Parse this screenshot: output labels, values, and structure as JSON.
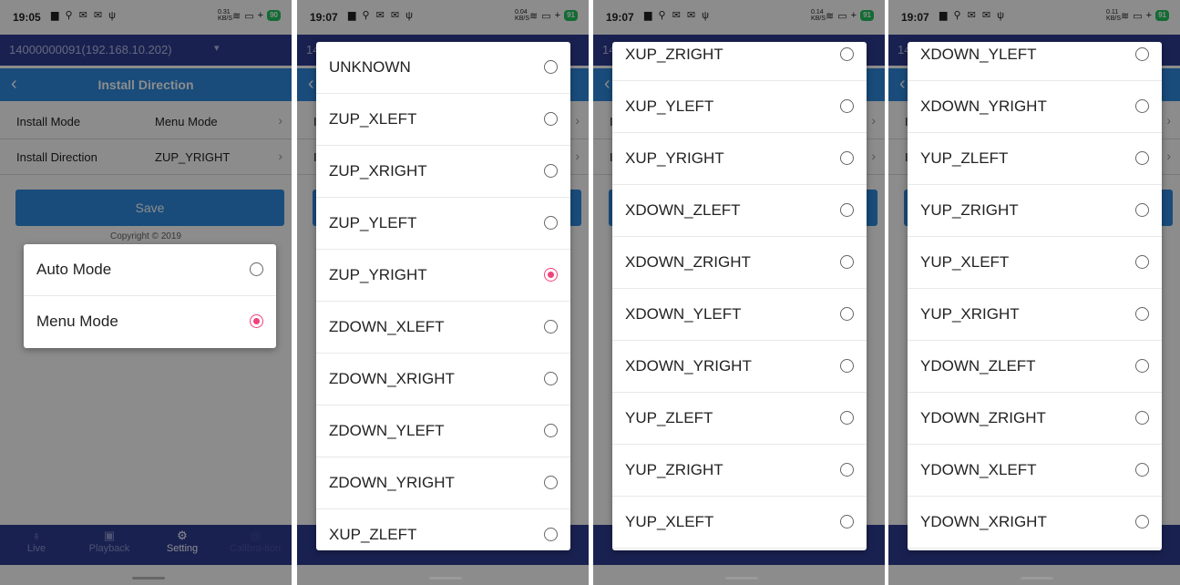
{
  "accent_color": "#f0437a",
  "screens": [
    {
      "status": {
        "time": "19:05",
        "speed_top": "0.31",
        "speed_bottom": "KB/S",
        "battery": "90"
      },
      "options": []
    },
    {
      "status": {
        "time": "19:07",
        "speed_top": "0.04",
        "speed_bottom": "KB/S",
        "battery": "91"
      },
      "options": [
        "UNKNOWN",
        "ZUP_XLEFT",
        "ZUP_XRIGHT",
        "ZUP_YLEFT",
        "ZUP_YRIGHT",
        "ZDOWN_XLEFT",
        "ZDOWN_XRIGHT",
        "ZDOWN_YLEFT",
        "ZDOWN_YRIGHT",
        "XUP_ZLEFT"
      ]
    },
    {
      "status": {
        "time": "19:07",
        "speed_top": "0.14",
        "speed_bottom": "KB/S",
        "battery": "91"
      },
      "options": [
        "XUP_ZRIGHT",
        "XUP_YLEFT",
        "XUP_YRIGHT",
        "XDOWN_ZLEFT",
        "XDOWN_ZRIGHT",
        "XDOWN_YLEFT",
        "XDOWN_YRIGHT",
        "YUP_ZLEFT",
        "YUP_ZRIGHT",
        "YUP_XLEFT"
      ]
    },
    {
      "status": {
        "time": "19:07",
        "speed_top": "0.11",
        "speed_bottom": "KB/S",
        "battery": "91"
      },
      "options": [
        "XDOWN_YLEFT",
        "XDOWN_YRIGHT",
        "YUP_ZLEFT",
        "YUP_ZRIGHT",
        "YUP_XLEFT",
        "YUP_XRIGHT",
        "YDOWN_ZLEFT",
        "YDOWN_ZRIGHT",
        "YDOWN_XLEFT",
        "YDOWN_XRIGHT"
      ]
    }
  ],
  "app": {
    "device": "14000000091(192.168.10.202)",
    "title": "Install Direction",
    "install_mode_label": "Install Mode",
    "install_mode_value": "Menu Mode",
    "install_direction_label": "Install Direction",
    "install_direction_value": "ZUP_YRIGHT",
    "save_label": "Save",
    "copyright": "Copyright © 2019",
    "tabs": [
      {
        "label": "Live",
        "icon": "medal-icon"
      },
      {
        "label": "Playback",
        "icon": "image-icon"
      },
      {
        "label": "Setting",
        "icon": "gear-icon"
      },
      {
        "label": "Calibra-tion",
        "icon": "target-icon"
      }
    ]
  },
  "mode_dialog": {
    "options": [
      "Auto Mode",
      "Menu Mode"
    ],
    "selected": "Menu Mode"
  },
  "direction_selected": "ZUP_YRIGHT"
}
